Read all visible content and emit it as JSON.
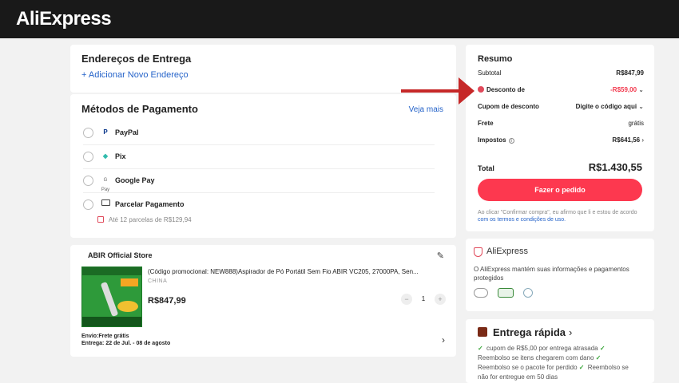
{
  "header": {
    "logo": "AliExpress"
  },
  "address": {
    "title": "Endereços de Entrega",
    "add_label": "+ Adicionar Novo Endereço"
  },
  "payment": {
    "title": "Métodos de Pagamento",
    "see_more": "Veja mais",
    "methods": [
      {
        "label": "PayPal",
        "icon": "paypal-icon"
      },
      {
        "label": "Pix",
        "icon": "pix-icon"
      },
      {
        "label": "Google Pay",
        "icon": "google-pay-icon"
      },
      {
        "label": "Parcelar Pagamento",
        "icon": "card-icon"
      }
    ],
    "installment_note": "Até 12 parcelas de R$129,94"
  },
  "store": {
    "name": "ABIR Official Store",
    "product_title": "(Código promocional: NEW888)Aspirador de Pó Portátil Sem Fio ABIR VC205, 27000PA, Sen...",
    "origin": "CHINA",
    "price": "R$847,99",
    "quantity": "1",
    "minus": "−",
    "plus": "+",
    "shipping": "Envio:Frete grátis",
    "delivery": "Entrega: 22 de Jul. - 08 de agosto"
  },
  "summary": {
    "title": "Resumo",
    "subtotal_label": "Subtotal",
    "subtotal_value": "R$847,99",
    "discount_label": "Desconto de",
    "discount_value": "-R$59,00",
    "coupon_label": "Cupom de desconto",
    "coupon_value": "Digite o código aqui",
    "shipping_label": "Frete",
    "shipping_value": "grátis",
    "tax_label": "Impostos",
    "tax_value": "R$641,56",
    "total_label": "Total",
    "total_value": "R$1.430,55",
    "order_button": "Fazer o pedido",
    "terms_prefix": "Ao clicar \"Confirmar compra\", eu afirmo que li e estou de acordo",
    "terms_link": "com os termos e condições de uso."
  },
  "trust": {
    "brand": "AliExpress",
    "description": "O AliExpress mantém suas informações e pagamentos protegidos"
  },
  "fast_delivery": {
    "title": "Entrega rápida",
    "chevron": "›",
    "line1": "cupom de R$5,00 por entrega atrasada",
    "line2": "Reembolso se itens chegarem com dano",
    "line3": "Reembolso se o pacote for perdido",
    "line4": "Reembolso se",
    "line5": "não for entregue em 50 dias"
  },
  "colors": {
    "accent": "#fd384f",
    "link": "#2563c9",
    "header": "#191919",
    "annotation": "#c62828"
  }
}
